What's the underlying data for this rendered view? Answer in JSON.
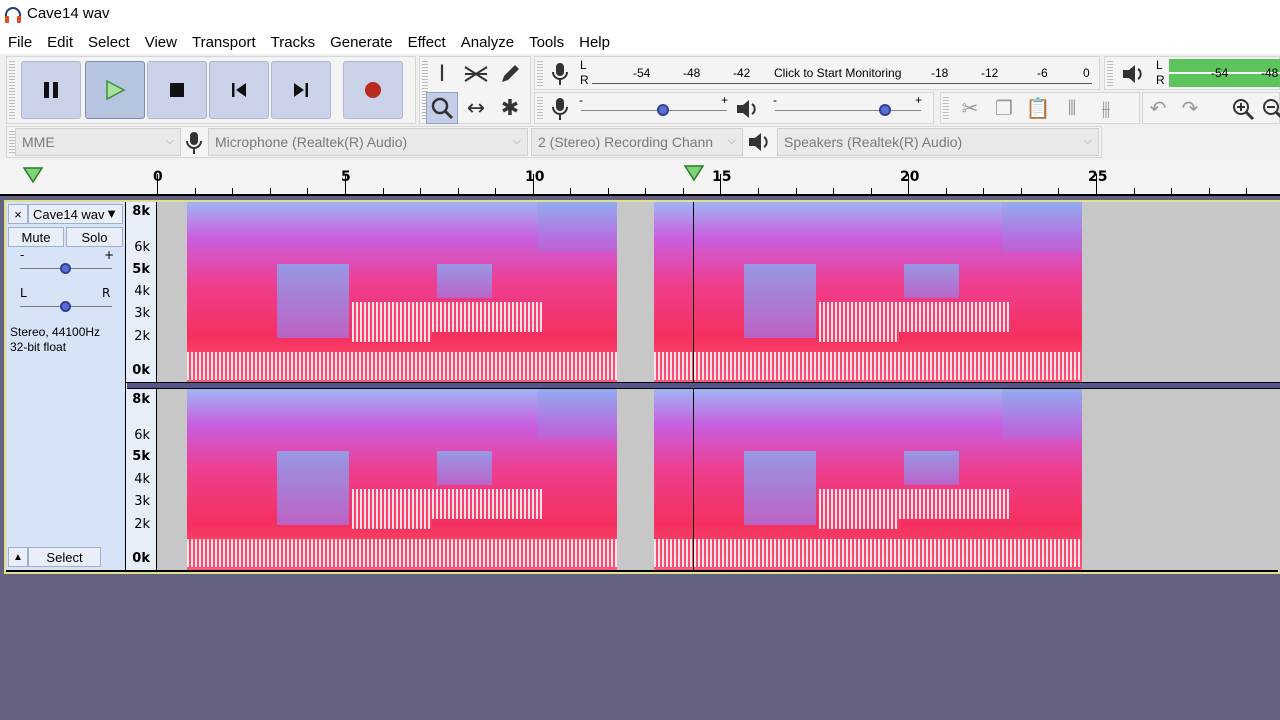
{
  "window": {
    "title": "Cave14 wav"
  },
  "menu": [
    "File",
    "Edit",
    "Select",
    "View",
    "Transport",
    "Tracks",
    "Generate",
    "Effect",
    "Analyze",
    "Tools",
    "Help"
  ],
  "meters": {
    "record_labels": [
      "-54",
      "-48",
      "-42"
    ],
    "record_prompt": "Click to Start Monitoring",
    "record_labels_right": [
      "-18",
      "-12",
      "-6",
      "0"
    ],
    "lr": [
      "L",
      "R"
    ],
    "play_labels": [
      "-54",
      "-48"
    ]
  },
  "devices": {
    "host": "MME",
    "input": "Microphone (Realtek(R) Audio)",
    "channels": "2 (Stereo) Recording Chann",
    "output": "Speakers (Realtek(R) Audio)"
  },
  "timeline": {
    "labels": [
      "0",
      "5",
      "10",
      "15",
      "20",
      "25"
    ]
  },
  "track": {
    "name": "Cave14 wav",
    "mute": "Mute",
    "solo": "Solo",
    "gain_minus": "-",
    "gain_plus": "+",
    "pan_left": "L",
    "pan_right": "R",
    "info_line1": "Stereo, 44100Hz",
    "info_line2": "32-bit float",
    "select": "Select",
    "close": "×",
    "ruler_labels": [
      "8k",
      "6k",
      "5k",
      "4k",
      "3k",
      "2k",
      "0k"
    ]
  }
}
